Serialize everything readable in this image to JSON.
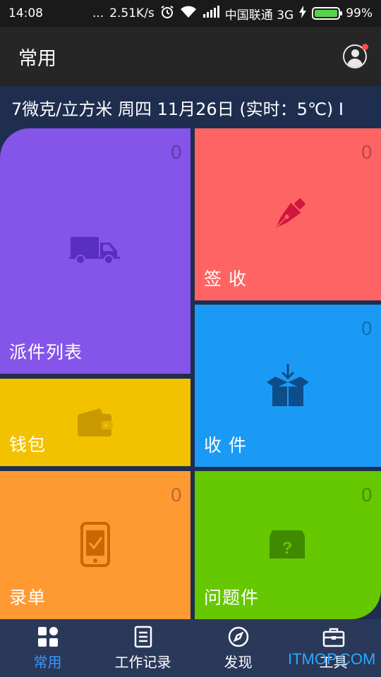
{
  "status_bar": {
    "time": "14:08",
    "dots": "...",
    "speed": "2.51K/s",
    "carrier": "中国联通 3G",
    "battery": "99%",
    "battery_level": 0.99
  },
  "header": {
    "title": "常用"
  },
  "ticker": {
    "text": "7微克/立方米  周四 11月26日 (实时：5℃)  I"
  },
  "tiles": {
    "dispatch": {
      "label": "派件列表",
      "count": "0"
    },
    "sign": {
      "label": "签 收",
      "count": "0"
    },
    "wallet": {
      "label": "钱包"
    },
    "receive": {
      "label": "收 件",
      "count": "0"
    },
    "entry": {
      "label": "录单",
      "count": "0"
    },
    "problem": {
      "label": "问题件",
      "count": "0"
    }
  },
  "nav": {
    "items": [
      {
        "label": "常用",
        "icon": "grid-icon"
      },
      {
        "label": "工作记录",
        "icon": "document-icon"
      },
      {
        "label": "发现",
        "icon": "compass-icon"
      },
      {
        "label": "工具",
        "icon": "toolbox-icon"
      }
    ]
  },
  "watermark": "ITMOP.COM",
  "colors": {
    "accent": "#3a98ff",
    "dispatch": "#8554e8",
    "sign": "#fe6463",
    "wallet": "#f2c100",
    "receive": "#1b9af5",
    "entry": "#ff9a32",
    "problem": "#66c800"
  }
}
